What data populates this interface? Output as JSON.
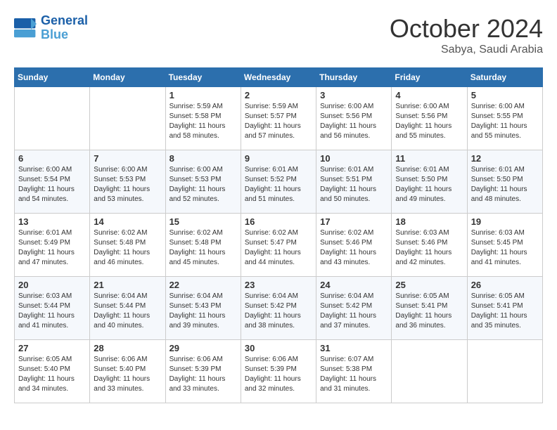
{
  "header": {
    "logo_line1": "General",
    "logo_line2": "Blue",
    "month": "October 2024",
    "location": "Sabya, Saudi Arabia"
  },
  "weekdays": [
    "Sunday",
    "Monday",
    "Tuesday",
    "Wednesday",
    "Thursday",
    "Friday",
    "Saturday"
  ],
  "weeks": [
    [
      {
        "day": "",
        "content": ""
      },
      {
        "day": "",
        "content": ""
      },
      {
        "day": "1",
        "content": "Sunrise: 5:59 AM\nSunset: 5:58 PM\nDaylight: 11 hours and 58 minutes."
      },
      {
        "day": "2",
        "content": "Sunrise: 5:59 AM\nSunset: 5:57 PM\nDaylight: 11 hours and 57 minutes."
      },
      {
        "day": "3",
        "content": "Sunrise: 6:00 AM\nSunset: 5:56 PM\nDaylight: 11 hours and 56 minutes."
      },
      {
        "day": "4",
        "content": "Sunrise: 6:00 AM\nSunset: 5:56 PM\nDaylight: 11 hours and 55 minutes."
      },
      {
        "day": "5",
        "content": "Sunrise: 6:00 AM\nSunset: 5:55 PM\nDaylight: 11 hours and 55 minutes."
      }
    ],
    [
      {
        "day": "6",
        "content": "Sunrise: 6:00 AM\nSunset: 5:54 PM\nDaylight: 11 hours and 54 minutes."
      },
      {
        "day": "7",
        "content": "Sunrise: 6:00 AM\nSunset: 5:53 PM\nDaylight: 11 hours and 53 minutes."
      },
      {
        "day": "8",
        "content": "Sunrise: 6:00 AM\nSunset: 5:53 PM\nDaylight: 11 hours and 52 minutes."
      },
      {
        "day": "9",
        "content": "Sunrise: 6:01 AM\nSunset: 5:52 PM\nDaylight: 11 hours and 51 minutes."
      },
      {
        "day": "10",
        "content": "Sunrise: 6:01 AM\nSunset: 5:51 PM\nDaylight: 11 hours and 50 minutes."
      },
      {
        "day": "11",
        "content": "Sunrise: 6:01 AM\nSunset: 5:50 PM\nDaylight: 11 hours and 49 minutes."
      },
      {
        "day": "12",
        "content": "Sunrise: 6:01 AM\nSunset: 5:50 PM\nDaylight: 11 hours and 48 minutes."
      }
    ],
    [
      {
        "day": "13",
        "content": "Sunrise: 6:01 AM\nSunset: 5:49 PM\nDaylight: 11 hours and 47 minutes."
      },
      {
        "day": "14",
        "content": "Sunrise: 6:02 AM\nSunset: 5:48 PM\nDaylight: 11 hours and 46 minutes."
      },
      {
        "day": "15",
        "content": "Sunrise: 6:02 AM\nSunset: 5:48 PM\nDaylight: 11 hours and 45 minutes."
      },
      {
        "day": "16",
        "content": "Sunrise: 6:02 AM\nSunset: 5:47 PM\nDaylight: 11 hours and 44 minutes."
      },
      {
        "day": "17",
        "content": "Sunrise: 6:02 AM\nSunset: 5:46 PM\nDaylight: 11 hours and 43 minutes."
      },
      {
        "day": "18",
        "content": "Sunrise: 6:03 AM\nSunset: 5:46 PM\nDaylight: 11 hours and 42 minutes."
      },
      {
        "day": "19",
        "content": "Sunrise: 6:03 AM\nSunset: 5:45 PM\nDaylight: 11 hours and 41 minutes."
      }
    ],
    [
      {
        "day": "20",
        "content": "Sunrise: 6:03 AM\nSunset: 5:44 PM\nDaylight: 11 hours and 41 minutes."
      },
      {
        "day": "21",
        "content": "Sunrise: 6:04 AM\nSunset: 5:44 PM\nDaylight: 11 hours and 40 minutes."
      },
      {
        "day": "22",
        "content": "Sunrise: 6:04 AM\nSunset: 5:43 PM\nDaylight: 11 hours and 39 minutes."
      },
      {
        "day": "23",
        "content": "Sunrise: 6:04 AM\nSunset: 5:42 PM\nDaylight: 11 hours and 38 minutes."
      },
      {
        "day": "24",
        "content": "Sunrise: 6:04 AM\nSunset: 5:42 PM\nDaylight: 11 hours and 37 minutes."
      },
      {
        "day": "25",
        "content": "Sunrise: 6:05 AM\nSunset: 5:41 PM\nDaylight: 11 hours and 36 minutes."
      },
      {
        "day": "26",
        "content": "Sunrise: 6:05 AM\nSunset: 5:41 PM\nDaylight: 11 hours and 35 minutes."
      }
    ],
    [
      {
        "day": "27",
        "content": "Sunrise: 6:05 AM\nSunset: 5:40 PM\nDaylight: 11 hours and 34 minutes."
      },
      {
        "day": "28",
        "content": "Sunrise: 6:06 AM\nSunset: 5:40 PM\nDaylight: 11 hours and 33 minutes."
      },
      {
        "day": "29",
        "content": "Sunrise: 6:06 AM\nSunset: 5:39 PM\nDaylight: 11 hours and 33 minutes."
      },
      {
        "day": "30",
        "content": "Sunrise: 6:06 AM\nSunset: 5:39 PM\nDaylight: 11 hours and 32 minutes."
      },
      {
        "day": "31",
        "content": "Sunrise: 6:07 AM\nSunset: 5:38 PM\nDaylight: 11 hours and 31 minutes."
      },
      {
        "day": "",
        "content": ""
      },
      {
        "day": "",
        "content": ""
      }
    ]
  ]
}
